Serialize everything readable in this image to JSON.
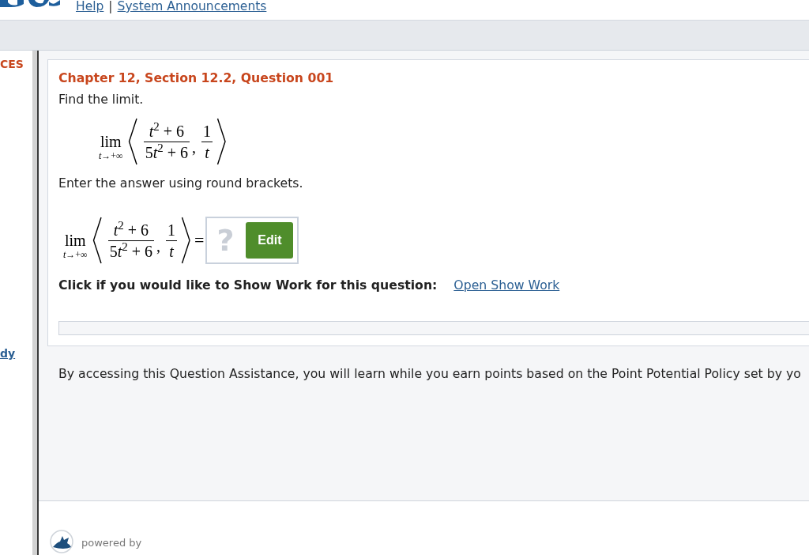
{
  "header": {
    "help_link": "Help",
    "separator": "|",
    "announcements_link": "System Announcements"
  },
  "sidebar": {
    "items": [
      {
        "kind": "heading",
        "label": "CES"
      },
      {
        "kind": "link",
        "label": "dy"
      }
    ]
  },
  "question": {
    "title": "Chapter 12, Section 12.2, Question 001",
    "prompt": "Find the limit.",
    "formula": {
      "operator": "lim",
      "subscript": "t→+∞",
      "components": [
        {
          "numerator": "t$^{2}$ + 6",
          "denominator": "5t$^{2}$ + 6"
        },
        {
          "numerator": "1",
          "denominator": "t"
        }
      ],
      "separator": ","
    },
    "instruction": "Enter the answer using round brackets.",
    "answer_formula": {
      "operator": "lim",
      "subscript": "t→+∞",
      "components": [
        {
          "numerator": "t$^{2}$ + 6",
          "denominator": "5t$^{2}$ + 6"
        },
        {
          "numerator": "1",
          "denominator": "t"
        }
      ],
      "separator": ",",
      "equals": "="
    },
    "answer": {
      "placeholder": "?",
      "edit_button": "Edit"
    },
    "show_work": {
      "label": "Click if you would like to Show Work for this question:",
      "link": "Open Show Work"
    }
  },
  "notice": "By accessing this Question Assistance, you will learn while you earn points based on the Point Potential Policy set by yo",
  "footer": {
    "powered_by": "powered by"
  }
}
